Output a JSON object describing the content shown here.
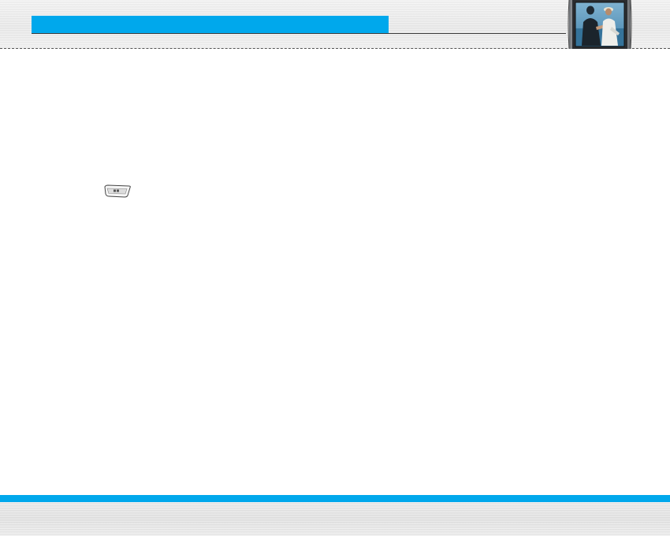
{
  "header": {
    "title": "",
    "accent_color": "#00a8ec"
  },
  "thumbnail": {
    "icon": "phone-with-photo-icon"
  },
  "content": {
    "key_icon": "key-button-icon"
  },
  "footer": {
    "accent_color": "#00a8ec"
  }
}
